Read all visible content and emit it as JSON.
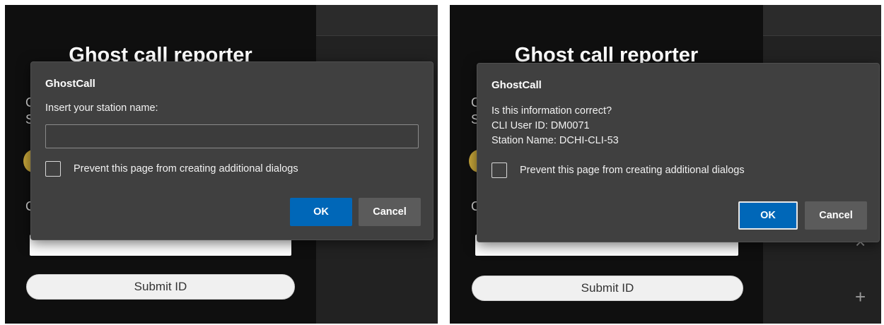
{
  "left": {
    "page_title": "Ghost call reporter",
    "peek_chars": [
      "C",
      "S",
      "C"
    ],
    "submit_label": "Submit ID",
    "dialog": {
      "title": "GhostCall",
      "message": "Insert your station name:",
      "checkbox_label": "Prevent this page from creating additional dialogs",
      "ok_label": "OK",
      "cancel_label": "Cancel"
    }
  },
  "right": {
    "page_title": "Ghost call reporter",
    "peek_chars": [
      "C",
      "S",
      "C"
    ],
    "submit_label": "Submit ID",
    "side_glyphs": [
      "×",
      "+"
    ],
    "dialog": {
      "title": "GhostCall",
      "message_lines": [
        "Is this information correct?",
        "CLI User ID: DM0071",
        "Station Name: DCHI-CLI-53"
      ],
      "checkbox_label": "Prevent this page from creating additional dialogs",
      "ok_label": "OK",
      "cancel_label": "Cancel"
    }
  },
  "colors": {
    "dialog_bg": "#404040",
    "ok_button": "#0067b8",
    "cancel_button": "#5b5b5b",
    "page_bg": "#0f0f0f",
    "accent_dot": "#c7a63a"
  }
}
